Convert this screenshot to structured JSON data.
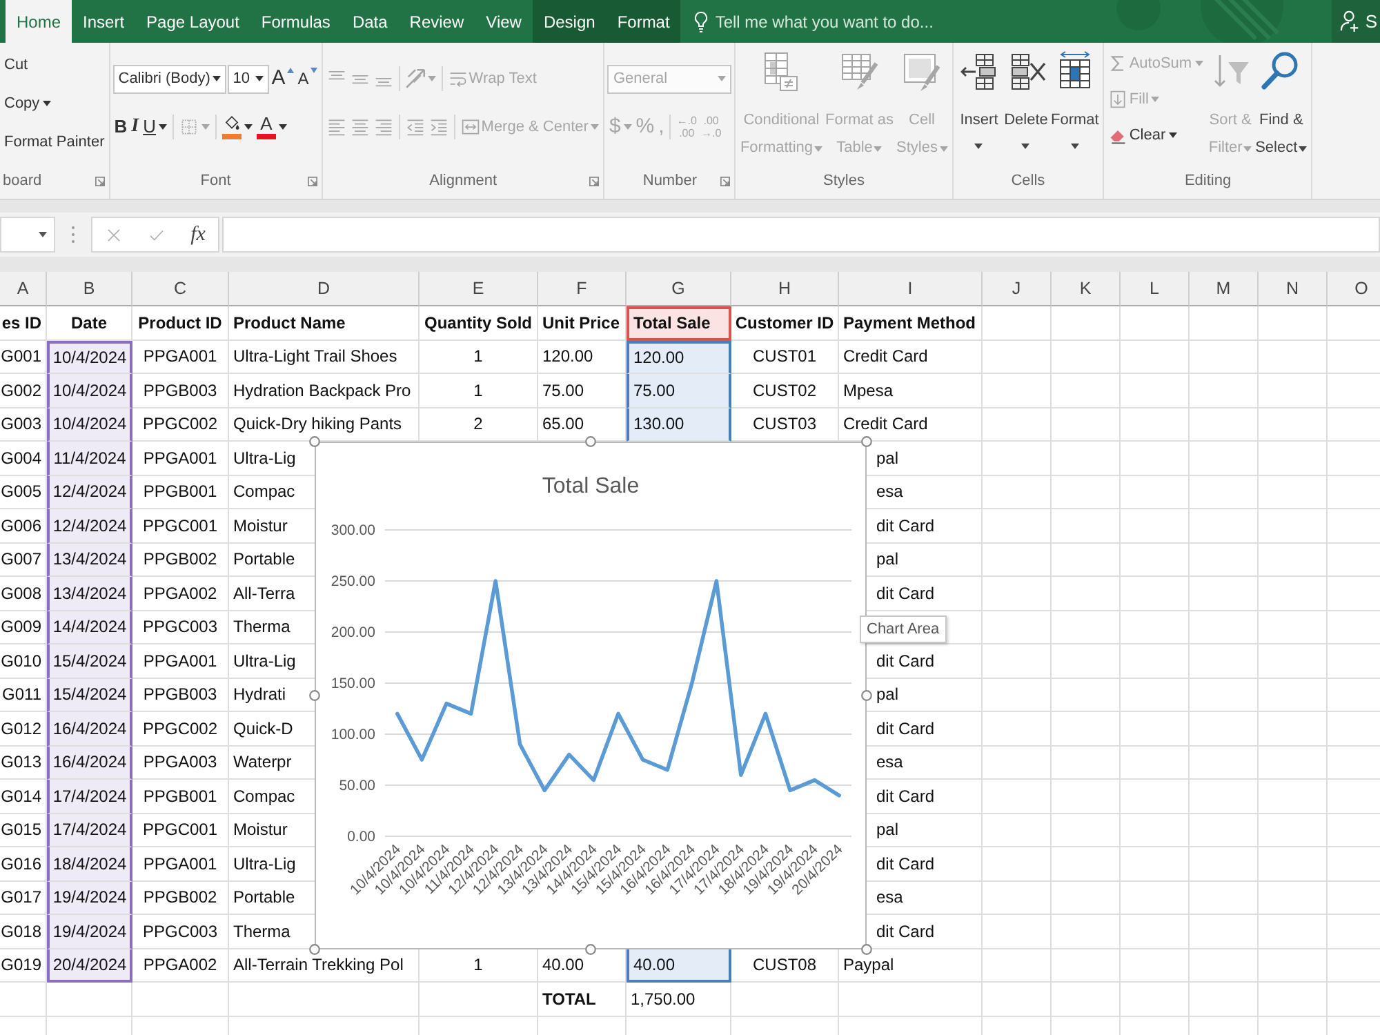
{
  "ribbon_tabs": [
    {
      "label": "Home",
      "selected": true,
      "kind": "standard"
    },
    {
      "label": "Insert",
      "selected": false,
      "kind": "standard"
    },
    {
      "label": "Page Layout",
      "selected": false,
      "kind": "standard"
    },
    {
      "label": "Formulas",
      "selected": false,
      "kind": "standard"
    },
    {
      "label": "Data",
      "selected": false,
      "kind": "standard"
    },
    {
      "label": "Review",
      "selected": false,
      "kind": "standard"
    },
    {
      "label": "View",
      "selected": false,
      "kind": "standard"
    },
    {
      "label": "Design",
      "selected": false,
      "kind": "contextual"
    },
    {
      "label": "Format",
      "selected": false,
      "kind": "contextual"
    }
  ],
  "tell_me": {
    "placeholder": "Tell me what you want to do..."
  },
  "account": {
    "label": "S"
  },
  "ribbon": {
    "groups": [
      {
        "kind": "clipboard",
        "group_label": "board",
        "launcher": true,
        "lines": [
          {
            "controls": [
              {
                "kind": "cut",
                "label": "Cut",
                "dropdown": false,
                "disabled": false
              }
            ]
          },
          {
            "controls": [
              {
                "kind": "copy",
                "label": "Copy",
                "dropdown": true,
                "disabled": false
              }
            ]
          },
          {
            "controls": [
              {
                "kind": "format_painter",
                "label": "Format Painter",
                "dropdown": false,
                "disabled": false
              }
            ]
          }
        ]
      },
      {
        "kind": "font",
        "group_label": "Font",
        "launcher": true,
        "lines": [
          {
            "controls": [
              {
                "kind": "font_name",
                "value": "Calibri (Body)",
                "dropdown": true,
                "disabled": false
              },
              {
                "kind": "font_size",
                "value": "10",
                "dropdown": true,
                "disabled": false
              },
              {
                "kind": "grow_font",
                "label": "A",
                "dropdown": false,
                "disabled": false
              },
              {
                "kind": "shrink_font",
                "label": "A",
                "dropdown": false,
                "disabled": false
              }
            ]
          },
          {
            "controls": [
              {
                "kind": "bold",
                "label": "B",
                "dropdown": false,
                "disabled": false
              },
              {
                "kind": "italic",
                "label": "I",
                "dropdown": false,
                "disabled": false
              },
              {
                "kind": "underline",
                "label": "U",
                "dropdown": true,
                "disabled": false
              },
              {
                "kind": "separator"
              },
              {
                "kind": "borders",
                "dropdown": true,
                "disabled": true
              },
              {
                "kind": "separator"
              },
              {
                "kind": "fill_color",
                "color": "#ed7d31",
                "dropdown": true,
                "disabled": false
              },
              {
                "kind": "font_color",
                "label": "A",
                "color": "#e81123",
                "dropdown": true,
                "disabled": false
              }
            ]
          }
        ]
      },
      {
        "kind": "alignment",
        "group_label": "Alignment",
        "launcher": true,
        "lines": [
          {
            "controls": [
              {
                "kind": "top_align",
                "dropdown": false,
                "disabled": true
              },
              {
                "kind": "middle_align",
                "dropdown": false,
                "disabled": true
              },
              {
                "kind": "bottom_align",
                "dropdown": false,
                "disabled": true
              },
              {
                "kind": "separator"
              },
              {
                "kind": "orientation",
                "dropdown": true,
                "disabled": true
              },
              {
                "kind": "separator"
              },
              {
                "kind": "wrap_text",
                "label": "Wrap Text",
                "dropdown": false,
                "disabled": true
              }
            ]
          },
          {
            "controls": [
              {
                "kind": "align_left",
                "dropdown": false,
                "disabled": true
              },
              {
                "kind": "align_center",
                "dropdown": false,
                "disabled": true
              },
              {
                "kind": "align_right",
                "dropdown": false,
                "disabled": true
              },
              {
                "kind": "separator"
              },
              {
                "kind": "decrease_indent",
                "dropdown": false,
                "disabled": true
              },
              {
                "kind": "increase_indent",
                "dropdown": false,
                "disabled": true
              },
              {
                "kind": "separator"
              },
              {
                "kind": "merge_center",
                "label": "Merge & Center",
                "dropdown": true,
                "disabled": true
              }
            ]
          }
        ]
      },
      {
        "kind": "number",
        "group_label": "Number",
        "launcher": true,
        "lines": [
          {
            "controls": [
              {
                "kind": "number_format",
                "value": "General",
                "dropdown": true,
                "disabled": true
              }
            ]
          },
          {
            "controls": [
              {
                "kind": "currency",
                "label": "$",
                "dropdown": true,
                "disabled": true
              },
              {
                "kind": "percent",
                "label": "%",
                "dropdown": false,
                "disabled": true
              },
              {
                "kind": "comma",
                "label": ",",
                "dropdown": false,
                "disabled": true
              },
              {
                "kind": "separator"
              },
              {
                "kind": "increase_decimal",
                "label_lines": [
                  "←.0",
                  ".00"
                ],
                "dropdown": false,
                "disabled": true
              },
              {
                "kind": "decrease_decimal",
                "label_lines": [
                  ".00",
                  "→.0"
                ],
                "dropdown": false,
                "disabled": true
              }
            ]
          }
        ]
      },
      {
        "kind": "styles",
        "group_label": "Styles",
        "launcher": false,
        "large_buttons": [
          {
            "kind": "conditional_formatting",
            "label_lines": [
              "Conditional",
              "Formatting"
            ],
            "dropdown": true,
            "disabled": true
          },
          {
            "kind": "format_as_table",
            "label_lines": [
              "Format as",
              "Table"
            ],
            "dropdown": true,
            "disabled": true
          },
          {
            "kind": "cell_styles",
            "label_lines": [
              "Cell",
              "Styles"
            ],
            "dropdown": true,
            "disabled": true
          }
        ]
      },
      {
        "kind": "cells",
        "group_label": "Cells",
        "launcher": false,
        "large_buttons": [
          {
            "kind": "insert",
            "label_lines": [
              "Insert"
            ],
            "dropdown": true,
            "disabled": false
          },
          {
            "kind": "delete",
            "label_lines": [
              "Delete"
            ],
            "dropdown": true,
            "disabled": false
          },
          {
            "kind": "format",
            "label_lines": [
              "Format"
            ],
            "dropdown": true,
            "disabled": false
          }
        ]
      },
      {
        "kind": "editing",
        "group_label": "Editing",
        "launcher": false,
        "lines": [
          {
            "controls": [
              {
                "kind": "autosum",
                "label": "AutoSum",
                "dropdown": true,
                "disabled": true
              }
            ]
          },
          {
            "controls": [
              {
                "kind": "fill",
                "label": "Fill",
                "dropdown": true,
                "disabled": true
              }
            ]
          },
          {
            "controls": [
              {
                "kind": "clear",
                "label": "Clear",
                "dropdown": true,
                "disabled": false
              }
            ]
          }
        ],
        "large_buttons": [
          {
            "kind": "sort_filter",
            "label_lines": [
              "Sort &",
              "Filter"
            ],
            "dropdown": true,
            "disabled": true
          },
          {
            "kind": "find_select",
            "label_lines": [
              "Find &",
              "Select"
            ],
            "dropdown": true,
            "disabled": false
          }
        ]
      }
    ]
  },
  "formula_bar": {
    "buttons": [
      {
        "kind": "cancel",
        "disabled": true
      },
      {
        "kind": "enter",
        "disabled": true
      },
      {
        "kind": "insert_function",
        "label": "fx",
        "disabled": false
      }
    ]
  },
  "sheet": {
    "columns": [
      {
        "letter": "A",
        "kind": "plain"
      },
      {
        "letter": "B",
        "kind": "category_range"
      },
      {
        "letter": "C",
        "kind": "plain"
      },
      {
        "letter": "D",
        "kind": "plain"
      },
      {
        "letter": "E",
        "kind": "plain"
      },
      {
        "letter": "F",
        "kind": "plain"
      },
      {
        "letter": "G",
        "kind": "value_range"
      },
      {
        "letter": "H",
        "kind": "plain"
      },
      {
        "letter": "I",
        "kind": "plain"
      },
      {
        "letter": "J",
        "kind": "plain"
      },
      {
        "letter": "K",
        "kind": "plain"
      },
      {
        "letter": "L",
        "kind": "plain"
      },
      {
        "letter": "M",
        "kind": "plain"
      },
      {
        "letter": "N",
        "kind": "plain"
      },
      {
        "letter": "O",
        "kind": "plain"
      }
    ],
    "rows": [
      {
        "kind": "header",
        "cells": [
          "es ID",
          "Date",
          "Product ID",
          "Product Name",
          "Quantity Sold",
          "Unit Price",
          "Total Sale",
          "Customer ID",
          "Payment Method"
        ]
      },
      {
        "kind": "data",
        "cells": [
          "G001",
          "10/4/2024",
          "PPGA001",
          "Ultra-Light Trail Shoes",
          "1",
          "120.00",
          "120.00",
          "CUST01",
          "Credit Card"
        ]
      },
      {
        "kind": "data",
        "cells": [
          "G002",
          "10/4/2024",
          "PPGB003",
          "Hydration Backpack Pro",
          "1",
          "75.00",
          "75.00",
          "CUST02",
          "Mpesa"
        ]
      },
      {
        "kind": "data",
        "cells": [
          "G003",
          "10/4/2024",
          "PPGC002",
          "Quick-Dry hiking Pants",
          "2",
          "65.00",
          "130.00",
          "CUST03",
          "Credit Card"
        ]
      },
      {
        "kind": "data",
        "cells": [
          "G004",
          "11/4/2024",
          "PPGA001",
          "Ultra-Lig",
          null,
          null,
          null,
          null,
          "pal"
        ]
      },
      {
        "kind": "data",
        "cells": [
          "G005",
          "12/4/2024",
          "PPGB001",
          "Compac",
          null,
          null,
          null,
          null,
          "esa"
        ]
      },
      {
        "kind": "data",
        "cells": [
          "G006",
          "12/4/2024",
          "PPGC001",
          "Moistur",
          null,
          null,
          null,
          null,
          "dit Card"
        ]
      },
      {
        "kind": "data",
        "cells": [
          "G007",
          "13/4/2024",
          "PPGB002",
          "Portable",
          null,
          null,
          null,
          null,
          "pal"
        ]
      },
      {
        "kind": "data",
        "cells": [
          "G008",
          "13/4/2024",
          "PPGA002",
          "All-Terra",
          null,
          null,
          null,
          null,
          "dit Card"
        ]
      },
      {
        "kind": "data",
        "cells": [
          "G009",
          "14/4/2024",
          "PPGC003",
          "Therma"
        ]
      },
      {
        "kind": "data",
        "cells": [
          "G010",
          "15/4/2024",
          "PPGA001",
          "Ultra-Lig",
          null,
          null,
          null,
          null,
          "dit Card"
        ]
      },
      {
        "kind": "data",
        "cells": [
          "G011",
          "15/4/2024",
          "PPGB003",
          "Hydrati",
          null,
          null,
          null,
          null,
          "pal"
        ]
      },
      {
        "kind": "data",
        "cells": [
          "G012",
          "16/4/2024",
          "PPGC002",
          "Quick-D",
          null,
          null,
          null,
          null,
          "dit Card"
        ]
      },
      {
        "kind": "data",
        "cells": [
          "G013",
          "16/4/2024",
          "PPGA003",
          "Waterpr",
          null,
          null,
          null,
          null,
          "esa"
        ]
      },
      {
        "kind": "data",
        "cells": [
          "G014",
          "17/4/2024",
          "PPGB001",
          "Compac",
          null,
          null,
          null,
          null,
          "dit Card"
        ]
      },
      {
        "kind": "data",
        "cells": [
          "G015",
          "17/4/2024",
          "PPGC001",
          "Moistur",
          null,
          null,
          null,
          null,
          "pal"
        ]
      },
      {
        "kind": "data",
        "cells": [
          "G016",
          "18/4/2024",
          "PPGA001",
          "Ultra-Lig",
          null,
          null,
          null,
          null,
          "dit Card"
        ]
      },
      {
        "kind": "data",
        "cells": [
          "G017",
          "19/4/2024",
          "PPGB002",
          "Portable",
          null,
          null,
          null,
          null,
          "esa"
        ]
      },
      {
        "kind": "data",
        "cells": [
          "G018",
          "19/4/2024",
          "PPGC003",
          "Therma",
          null,
          null,
          null,
          null,
          "dit Card"
        ]
      },
      {
        "kind": "data",
        "cells": [
          "G019",
          "20/4/2024",
          "PPGA002",
          "All-Terrain Trekking Pol",
          "1",
          "40.00",
          "40.00",
          "CUST08",
          "Paypal"
        ]
      },
      {
        "kind": "total",
        "cells": [
          null,
          null,
          null,
          null,
          null,
          {
            "text": "TOTAL",
            "bold": true
          },
          "1,750.00"
        ]
      }
    ]
  },
  "chart": {
    "selected": true,
    "tooltip": "Chart Area",
    "chart_data": {
      "type": "line",
      "title": "Total Sale",
      "categories": [
        "10/4/2024",
        "10/4/2024",
        "10/4/2024",
        "11/4/2024",
        "12/4/2024",
        "12/4/2024",
        "13/4/2024",
        "13/4/2024",
        "14/4/2024",
        "15/4/2024",
        "15/4/2024",
        "16/4/2024",
        "16/4/2024",
        "17/4/2024",
        "17/4/2024",
        "18/4/2024",
        "19/4/2024",
        "19/4/2024",
        "20/4/2024"
      ],
      "values": [
        120,
        75,
        130,
        120,
        250,
        90,
        45,
        80,
        55,
        120,
        75,
        65,
        150,
        250,
        60,
        120,
        45,
        55,
        40
      ],
      "color": "#5b9bd5",
      "ylim": [
        0,
        300
      ],
      "yticks": [
        {
          "value": 0,
          "label": "0.00"
        },
        {
          "value": 50,
          "label": "50.00"
        },
        {
          "value": 100,
          "label": "100.00"
        },
        {
          "value": 150,
          "label": "150.00"
        },
        {
          "value": 200,
          "label": "200.00"
        },
        {
          "value": 250,
          "label": "250.00"
        },
        {
          "value": 300,
          "label": "300.00"
        }
      ],
      "grid": true
    }
  }
}
